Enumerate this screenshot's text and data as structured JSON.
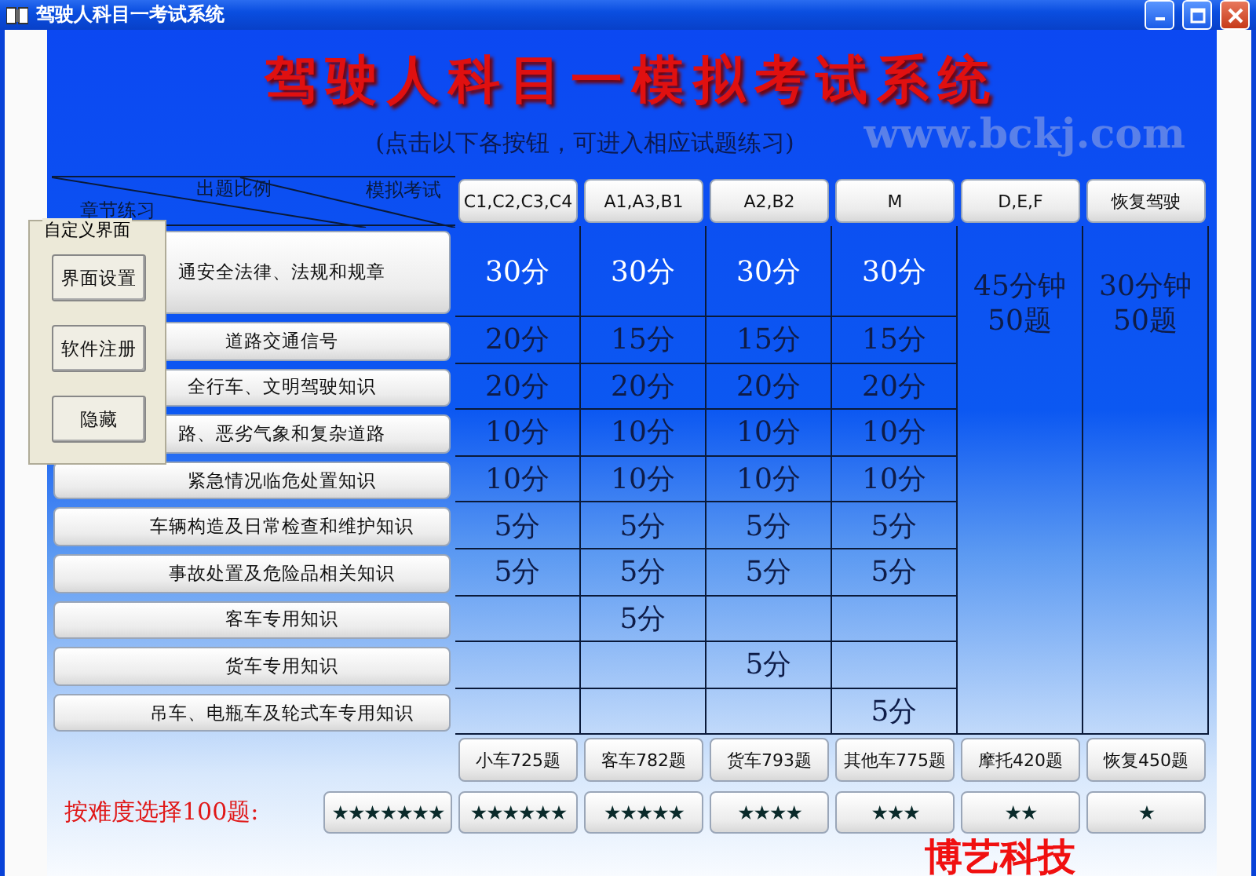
{
  "window": {
    "title": "驾驶人科目一考试系统"
  },
  "header": {
    "title": "驾驶人科目一模拟考试系统",
    "subtitle": "(点击以下各按钮，可进入相应试题练习)",
    "site": "www.bckj.com"
  },
  "table": {
    "corner": {
      "top": "出题比例",
      "right": "模拟考试",
      "left": "章节练习"
    },
    "exam_buttons": [
      "C1,C2,C3,C4",
      "A1,A3,B1",
      "A2,B2",
      "M",
      "D,E,F",
      "恢复驾驶"
    ],
    "chapters": [
      {
        "label": "通安全法律、法规和规章",
        "scores": [
          {
            "kind": "score",
            "text": "30分"
          },
          {
            "kind": "score",
            "text": "30分"
          },
          {
            "kind": "score",
            "text": "30分"
          },
          {
            "kind": "score",
            "text": "30分"
          }
        ]
      },
      {
        "label": "道路交通信号",
        "scores": [
          {
            "kind": "score",
            "text": "20分"
          },
          {
            "kind": "score",
            "text": "15分"
          },
          {
            "kind": "score",
            "text": "15分"
          },
          {
            "kind": "score",
            "text": "15分"
          }
        ]
      },
      {
        "label": "全行车、文明驾驶知识",
        "scores": [
          {
            "kind": "score",
            "text": "20分"
          },
          {
            "kind": "score",
            "text": "20分"
          },
          {
            "kind": "score",
            "text": "20分"
          },
          {
            "kind": "score",
            "text": "20分"
          }
        ]
      },
      {
        "label": "路、恶劣气象和复杂道路",
        "scores": [
          {
            "kind": "score",
            "text": "10分"
          },
          {
            "kind": "score",
            "text": "10分"
          },
          {
            "kind": "score",
            "text": "10分"
          },
          {
            "kind": "score",
            "text": "10分"
          }
        ]
      },
      {
        "label": "紧急情况临危处置知识",
        "scores": [
          {
            "kind": "score",
            "text": "10分"
          },
          {
            "kind": "score",
            "text": "10分"
          },
          {
            "kind": "score",
            "text": "10分"
          },
          {
            "kind": "score",
            "text": "10分"
          }
        ]
      },
      {
        "label": "车辆构造及日常检查和维护知识",
        "scores": [
          {
            "kind": "score",
            "text": "5分"
          },
          {
            "kind": "score",
            "text": "5分"
          },
          {
            "kind": "score",
            "text": "5分"
          },
          {
            "kind": "score",
            "text": "5分"
          }
        ]
      },
      {
        "label": "事故处置及危险品相关知识",
        "scores": [
          {
            "kind": "score",
            "text": "5分"
          },
          {
            "kind": "score",
            "text": "5分"
          },
          {
            "kind": "score",
            "text": "5分"
          },
          {
            "kind": "score",
            "text": "5分"
          }
        ]
      },
      {
        "label": "客车专用知识",
        "scores": [
          {
            "kind": "empty"
          },
          {
            "kind": "score",
            "text": "5分"
          },
          {
            "kind": "empty"
          },
          {
            "kind": "empty"
          }
        ]
      },
      {
        "label": "货车专用知识",
        "scores": [
          {
            "kind": "empty"
          },
          {
            "kind": "empty"
          },
          {
            "kind": "score",
            "text": "5分"
          },
          {
            "kind": "empty"
          }
        ]
      },
      {
        "label": "吊车、电瓶车及轮式车专用知识",
        "scores": [
          {
            "kind": "empty"
          },
          {
            "kind": "empty"
          },
          {
            "kind": "empty"
          },
          {
            "kind": "score",
            "text": "5分"
          }
        ]
      }
    ],
    "span_cells": [
      {
        "time": "45分钟",
        "count": "50题"
      },
      {
        "time": "30分钟",
        "count": "50题"
      }
    ],
    "count_buttons": [
      "小车725题",
      "客车782题",
      "货车793题",
      "其他车775题",
      "摩托420题",
      "恢复450题"
    ]
  },
  "difficulty": {
    "label": "按难度选择100题:",
    "buttons": [
      "★★★★★★★",
      "★★★★★★",
      "★★★★★",
      "★★★★",
      "★★★",
      "★★",
      "★"
    ]
  },
  "custom_panel": {
    "title": "自定义界面",
    "buttons": [
      "界面设置",
      "软件注册",
      "隐藏"
    ]
  },
  "marquee": "博艺科技"
}
